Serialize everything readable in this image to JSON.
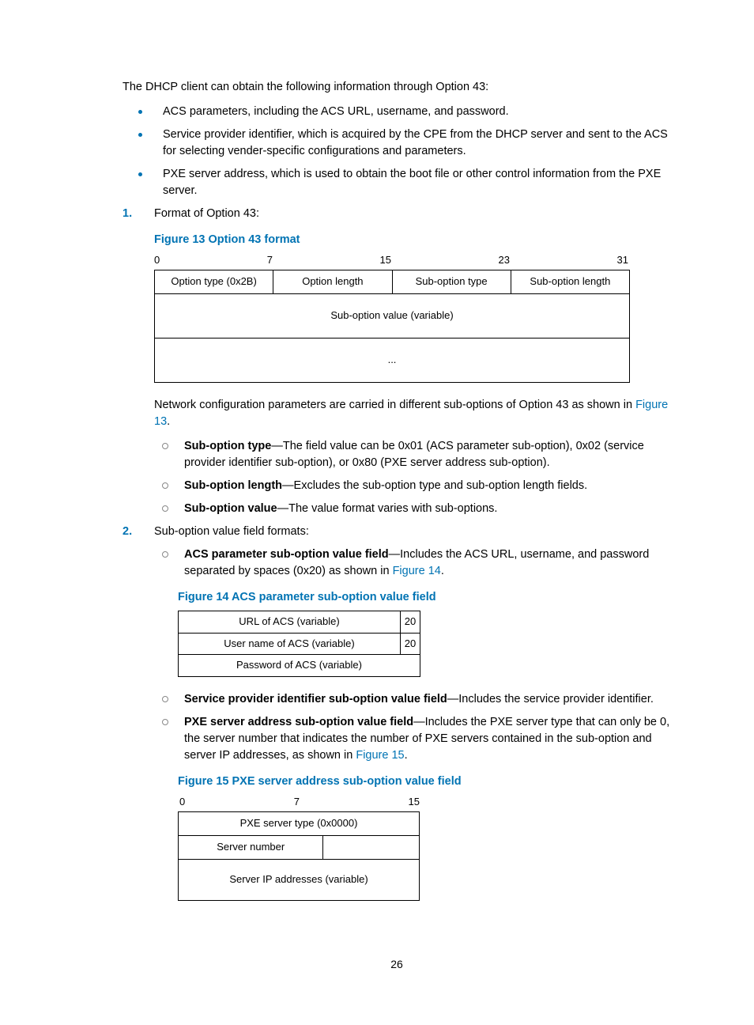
{
  "intro": "The DHCP client can obtain the following information through Option 43:",
  "bullets": {
    "b1": "ACS parameters, including the ACS URL, username, and password.",
    "b2": "Service provider identifier, which is acquired by the CPE from the DHCP server and sent to the ACS for selecting vender-specific configurations and parameters.",
    "b3": "PXE server address, which is used to obtain the boot file or other control information from the PXE server."
  },
  "steps": {
    "s1": {
      "num": "1.",
      "text": "Format of Option 43:"
    },
    "s2": {
      "num": "2.",
      "text": "Sub-option value field formats:"
    }
  },
  "fig13": {
    "caption": "Figure 13 Option 43 format",
    "ruler": {
      "r0": "0",
      "r7": "7",
      "r15": "15",
      "r23": "23",
      "r31": "31"
    },
    "cells": {
      "c1": "Option type (0x2B)",
      "c2": "Option length",
      "c3": "Sub-option type",
      "c4": "Sub-option length",
      "c5": "Sub-option value (variable)",
      "c6": "..."
    }
  },
  "after_fig13": {
    "pre": "Network configuration parameters are carried in different sub-options of Option 43 as shown in ",
    "link": "Figure 13",
    "post": "."
  },
  "sub_defs": {
    "d1": {
      "b": "Sub-option type",
      "rest": "—The field value can be 0x01 (ACS parameter sub-option), 0x02 (service provider identifier sub-option), or 0x80 (PXE server address sub-option)."
    },
    "d2": {
      "b": "Sub-option length",
      "rest": "—Excludes the sub-option type and sub-option length fields."
    },
    "d3": {
      "b": "Sub-option value",
      "rest": "—The value format varies with sub-options."
    }
  },
  "sub_fmts": {
    "f1": {
      "b": "ACS parameter sub-option value field",
      "pre": "—Includes the ACS URL, username, and password separated by spaces (0x20) as shown in ",
      "link": "Figure 14",
      "post": "."
    },
    "f2": {
      "b": "Service provider identifier sub-option value field",
      "rest": "—Includes the service provider identifier."
    },
    "f3": {
      "b": "PXE server address sub-option value field",
      "pre": "—Includes the PXE server type that can only be 0, the server number that indicates the number of PXE servers contained in the sub-option and server IP addresses, as shown in ",
      "link": "Figure 15",
      "post": "."
    }
  },
  "fig14": {
    "caption": "Figure 14 ACS parameter sub-option value field",
    "rows": {
      "r1a": "URL of ACS (variable)",
      "r1b": "20",
      "r2a": "User name of ACS (variable)",
      "r2b": "20",
      "r3a": "Password of ACS (variable)"
    }
  },
  "fig15": {
    "caption": "Figure 15 PXE server address sub-option value field",
    "ruler": {
      "r0": "0",
      "r7": "7",
      "r15": "15"
    },
    "cells": {
      "c1": "PXE server type (0x0000)",
      "c2": "Server number",
      "c3": "Server IP addresses (variable)"
    }
  },
  "page_number": "26"
}
